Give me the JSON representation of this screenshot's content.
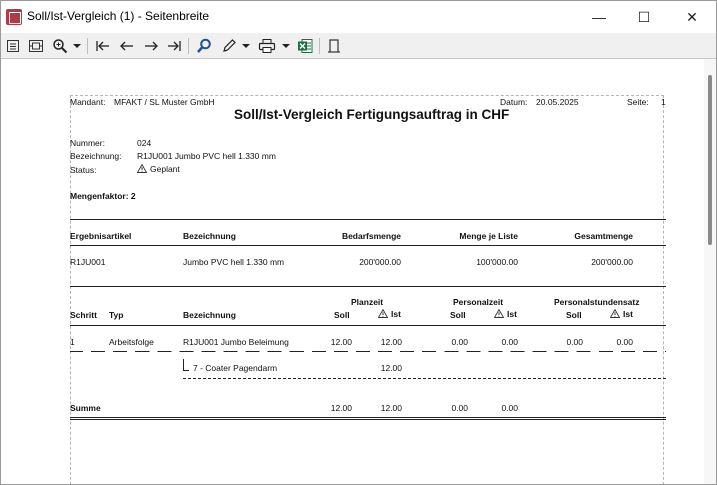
{
  "window": {
    "title": "Soll/Ist-Vergleich (1) - Seitenbreite",
    "minimize": "—",
    "maximize": "☐",
    "close": "✕"
  },
  "toolbar": {
    "icons": [
      "page-view-icon",
      "fit-page-icon",
      "zoom-icon",
      "dropdown-arrow-icon",
      "first-page-icon",
      "previous-page-icon",
      "next-page-icon",
      "last-page-icon",
      "search-icon",
      "edit-icon",
      "dropdown-arrow-icon",
      "print-icon",
      "dropdown-arrow-icon",
      "excel-icon",
      "page-format-icon"
    ]
  },
  "report": {
    "mandant_label": "Mandant:",
    "mandant_value": "MFAKT  /  SL Muster GmbH",
    "datum_label": "Datum:",
    "datum_value": "20.05.2025",
    "seite_label": "Seite:",
    "seite_value": "1",
    "title": "Soll/Ist-Vergleich Fertigungsauftrag in CHF",
    "nummer_label": "Nummer:",
    "nummer_value": "024",
    "bezeichnung_label": "Bezeichnung:",
    "bezeichnung_value": "R1JU001 Jumbo PVC hell 1.330 mm",
    "status_label": "Status:",
    "status_value": "Geplant",
    "mengenfaktor": "Mengenfaktor: 2",
    "table1": {
      "headers": [
        "Ergebnisartikel",
        "Bezeichnung",
        "Bedarfsmenge",
        "Menge je Liste",
        "Gesamtmenge"
      ],
      "row": [
        "R1JU001",
        "Jumbo PVC hell 1.330 mm",
        "200'000.00",
        "100'000.00",
        "200'000.00"
      ]
    },
    "table2": {
      "group_planzeit": "Planzeit",
      "group_personalzeit": "Personalzeit",
      "group_personalstundensatz": "Personalstundensatz",
      "h_schritt": "Schritt",
      "h_typ": "Typ",
      "h_bezeichnung": "Bezeichnung",
      "h_soll": "Soll",
      "h_ist": "Ist",
      "row": {
        "schritt": "1",
        "typ": "Arbeitsfolge",
        "bezeichnung": "R1JU001 Jumbo Beleimung",
        "plan_soll": "12.00",
        "plan_ist": "12.00",
        "pers_soll": "0.00",
        "pers_ist": "0.00",
        "satz_soll": "0.00",
        "satz_ist": "0.00"
      },
      "subrow": {
        "bezeichnung": "7 - Coater Pagendarm",
        "plan_ist": "12.00"
      },
      "summe": {
        "label": "Summe",
        "plan_soll": "12.00",
        "plan_ist": "12.00",
        "pers_soll": "0.00",
        "pers_ist": "0.00"
      }
    }
  }
}
